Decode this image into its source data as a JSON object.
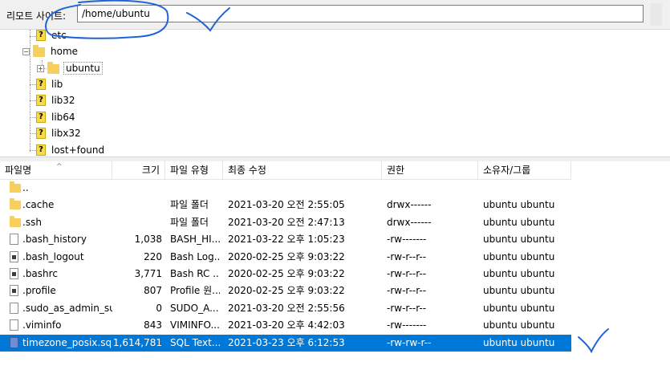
{
  "pathbar": {
    "label": "리모트 사이트:",
    "path_value": "/home/ubuntu"
  },
  "tree": {
    "items": [
      {
        "label": "etc",
        "icon": "question-folder-icon"
      },
      {
        "label": "home",
        "icon": "folder-icon",
        "expanded": true
      },
      {
        "label": "ubuntu",
        "icon": "folder-icon",
        "expander": "+"
      },
      {
        "label": "lib",
        "icon": "question-folder-icon"
      },
      {
        "label": "lib32",
        "icon": "question-folder-icon"
      },
      {
        "label": "lib64",
        "icon": "question-folder-icon"
      },
      {
        "label": "libx32",
        "icon": "question-folder-icon"
      },
      {
        "label": "lost+found",
        "icon": "question-folder-icon"
      }
    ],
    "expander_minus": "−"
  },
  "columns": {
    "name": "파일명",
    "size": "크기",
    "type": "파일 유형",
    "modified": "최종 수정",
    "perm": "권한",
    "owner": "소유자/그룹",
    "sort_indicator": "^"
  },
  "files": [
    {
      "name": "..",
      "size": "",
      "type": "",
      "modified": "",
      "perm": "",
      "owner": "",
      "icon": "folder-icon"
    },
    {
      "name": ".cache",
      "size": "",
      "type": "파일 폴더",
      "modified": "2021-03-20 오전 2:55:05",
      "perm": "drwx------",
      "owner": "ubuntu ubuntu",
      "icon": "folder-icon"
    },
    {
      "name": ".ssh",
      "size": "",
      "type": "파일 폴더",
      "modified": "2021-03-20 오전 2:47:13",
      "perm": "drwx------",
      "owner": "ubuntu ubuntu",
      "icon": "folder-icon"
    },
    {
      "name": ".bash_history",
      "size": "1,038",
      "type": "BASH_HI...",
      "modified": "2021-03-22 오후 1:05:23",
      "perm": "-rw-------",
      "owner": "ubuntu ubuntu",
      "icon": "file-icon"
    },
    {
      "name": ".bash_logout",
      "size": "220",
      "type": "Bash Log...",
      "modified": "2020-02-25 오후 9:03:22",
      "perm": "-rw-r--r--",
      "owner": "ubuntu ubuntu",
      "icon": "doc-icon"
    },
    {
      "name": ".bashrc",
      "size": "3,771",
      "type": "Bash RC ...",
      "modified": "2020-02-25 오후 9:03:22",
      "perm": "-rw-r--r--",
      "owner": "ubuntu ubuntu",
      "icon": "doc-icon"
    },
    {
      "name": ".profile",
      "size": "807",
      "type": "Profile 원...",
      "modified": "2020-02-25 오후 9:03:22",
      "perm": "-rw-r--r--",
      "owner": "ubuntu ubuntu",
      "icon": "doc-icon"
    },
    {
      "name": ".sudo_as_admin_su...",
      "size": "0",
      "type": "SUDO_A...",
      "modified": "2021-03-20 오전 2:55:56",
      "perm": "-rw-r--r--",
      "owner": "ubuntu ubuntu",
      "icon": "file-icon"
    },
    {
      "name": ".viminfo",
      "size": "843",
      "type": "VIMINFO...",
      "modified": "2021-03-20 오후 4:42:03",
      "perm": "-rw-------",
      "owner": "ubuntu ubuntu",
      "icon": "file-icon"
    },
    {
      "name": "timezone_posix.sql",
      "size": "1,614,781",
      "type": "SQL Text...",
      "modified": "2021-03-23 오후 6:12:53",
      "perm": "-rw-rw-r--",
      "owner": "ubuntu ubuntu",
      "icon": "sql-file-icon",
      "selected": true
    }
  ],
  "colors": {
    "selection": "#0078d7",
    "annotation": "#1f63d6",
    "folder": "#f6cf5e"
  }
}
